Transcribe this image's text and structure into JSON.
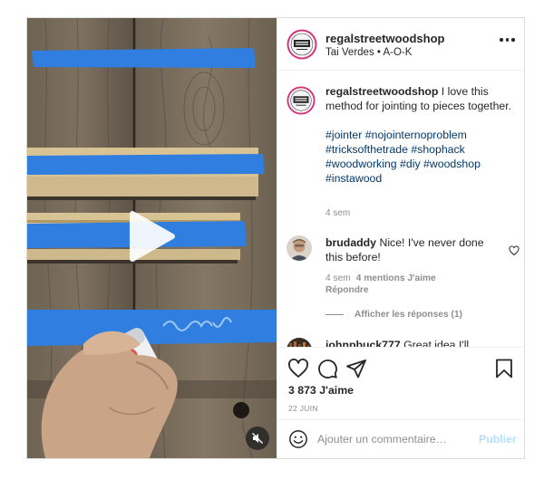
{
  "post": {
    "account": {
      "username": "regalstreetwoodshop",
      "location": "Tai Verdes • A-O-K",
      "avatar_icon": "regal-street-woodshop-logo",
      "avatar_text": "REGAL STREET WOODSHOP"
    },
    "media": {
      "type": "video",
      "play_icon": "play-icon",
      "mute_icon": "muted-speaker-icon"
    },
    "caption": {
      "username": "regalstreetwoodshop",
      "text": " I love this method for jointing to pieces together.",
      "hashtags": [
        "#jointer",
        "#nojointernoproblem",
        "#tricksofthetrade",
        "#shophack",
        "#woodworking",
        "#diy",
        "#woodshop",
        "#instawood"
      ],
      "time": "4 sem"
    },
    "comments": [
      {
        "username": "brudaddy",
        "text": " Nice! I've never done this before!",
        "time": "4 sem",
        "likes": "4 mentions J'aime",
        "reply_label": "Répondre",
        "view_replies": "Afficher les réponses (1)"
      },
      {
        "username": "johnpbuck777",
        "text": " Great idea I'll have to try that"
      }
    ],
    "actions": {
      "like_icon": "heart-icon",
      "comment_icon": "comment-icon",
      "share_icon": "paper-plane-icon",
      "save_icon": "bookmark-icon"
    },
    "likes_count": "3 873 J'aime",
    "date": "22 JUIN",
    "add_comment": {
      "placeholder": "Ajouter un commentaire…",
      "publish_label": "Publier",
      "emoji_icon": "smiley-icon"
    }
  },
  "colors": {
    "link": "#00376b",
    "secondary_text": "#8e8e8e",
    "publish_disabled": "#b2dffc",
    "tape_blue": "#2f7ee0",
    "border": "#dbdbdb"
  }
}
